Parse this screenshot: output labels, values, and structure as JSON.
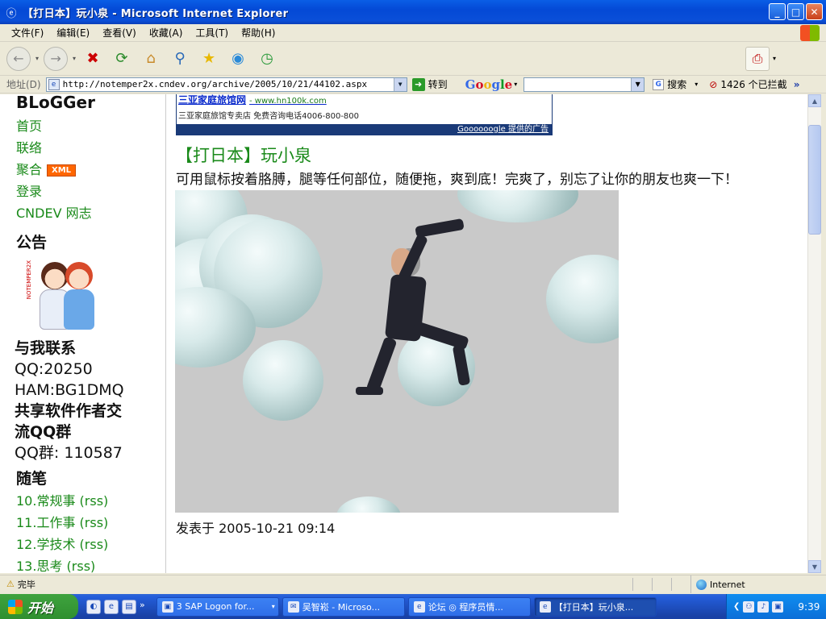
{
  "window": {
    "title": "【打日本】玩小泉 - Microsoft Internet Explorer",
    "controls": {
      "minimize": "_",
      "maximize": "□",
      "close": "✕"
    }
  },
  "menu": [
    "文件(F)",
    "编辑(E)",
    "查看(V)",
    "收藏(A)",
    "工具(T)",
    "帮助(H)"
  ],
  "toolbar": {
    "icons": [
      "back-icon",
      "forward-icon",
      "stop-icon",
      "refresh-icon",
      "home-icon",
      "search-icon",
      "favorites-icon",
      "media-icon",
      "history-icon",
      "pdf-icon"
    ]
  },
  "address_bar": {
    "label": "地址(D)",
    "url": "http://notemper2x.cndev.org/archive/2005/10/21/44102.aspx",
    "go_label": "转到",
    "google_search_label": "搜索",
    "google_search_value": "",
    "popups_blocked": "1426 个已拦截",
    "more": "»"
  },
  "sidebar": {
    "blog_title": "BLoGGer",
    "nav": [
      {
        "label": "首页"
      },
      {
        "label": "联络"
      },
      {
        "label": "聚合",
        "badge": "XML"
      },
      {
        "label": "登录"
      },
      {
        "label": "CNDEV 网志"
      }
    ],
    "announce_heading": "公告",
    "avatar_text": "NOTEMPER2X",
    "contact": {
      "heading": "与我联系",
      "qq": "QQ:20250",
      "ham": "HAM:BG1DMQ",
      "group_heading_1": "共享软件作者交",
      "group_heading_2": "流QQ群",
      "group": "QQ群: 110587"
    },
    "essays_heading": "随笔",
    "essays": [
      {
        "num": "10.",
        "label": "常规事 (rss)"
      },
      {
        "num": "11.",
        "label": "工作事 (rss)"
      },
      {
        "num": "12.",
        "label": "学技术 (rss)"
      },
      {
        "num": "13.",
        "label": "思考 (rss)"
      }
    ]
  },
  "ad": {
    "title": "三亚家庭旅馆网",
    "url": "- www.hn100k.com",
    "desc": "三亚家庭旅馆专卖店 免费咨询电话4006-800-800",
    "footer": "Goooooogle 提供的广告"
  },
  "post": {
    "title": "【打日本】玩小泉",
    "desc": "可用鼠标按着胳膊，腿等任何部位，随便拖，爽到底！完爽了，别忘了让你的朋友也爽一下！",
    "meta_prefix": "发表于",
    "meta_time": "2005-10-21 09:14"
  },
  "statusbar": {
    "text": "完毕",
    "zone": "Internet"
  },
  "taskbar": {
    "start": "开始",
    "tasks": [
      {
        "label": "3 SAP Logon for..."
      },
      {
        "label": "吴智崧 - Microso..."
      },
      {
        "label": "论坛 ◎ 程序员情..."
      },
      {
        "label": "【打日本】玩小泉..."
      }
    ],
    "clock": "9:39"
  }
}
